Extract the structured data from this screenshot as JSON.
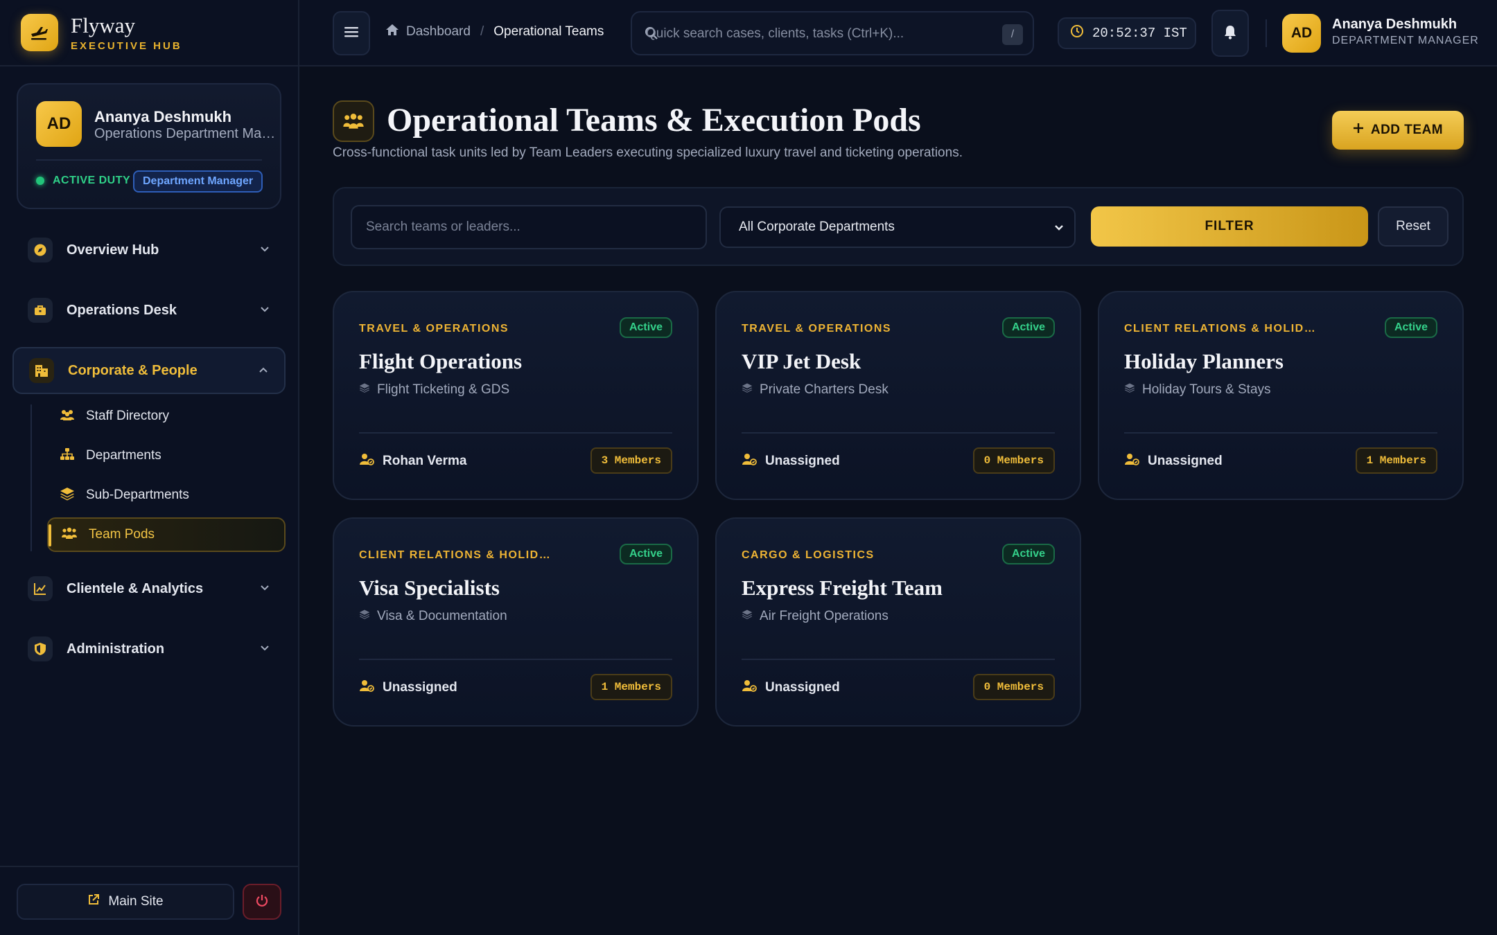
{
  "brand": {
    "name": "Flyway",
    "subtitle": "EXECUTIVE HUB"
  },
  "profile": {
    "initials": "AD",
    "name": "Ananya Deshmukh",
    "role": "Operations Department Manager",
    "duty_status": "ACTIVE DUTY",
    "badge": "Department Manager"
  },
  "sidebar": {
    "items": [
      {
        "label": "Overview Hub",
        "icon": "compass-icon"
      },
      {
        "label": "Operations Desk",
        "icon": "briefcase-icon"
      },
      {
        "label": "Corporate & People",
        "icon": "building-icon",
        "expanded": true
      },
      {
        "label": "Clientele & Analytics",
        "icon": "chart-line-icon"
      },
      {
        "label": "Administration",
        "icon": "shield-icon"
      }
    ],
    "sub_items": [
      {
        "label": "Staff Directory",
        "icon": "users-icon"
      },
      {
        "label": "Departments",
        "icon": "sitemap-icon"
      },
      {
        "label": "Sub-Departments",
        "icon": "layers-icon"
      },
      {
        "label": "Team Pods",
        "icon": "people-group-icon",
        "active": true
      }
    ],
    "footer": {
      "main_site": "Main Site"
    }
  },
  "topbar": {
    "breadcrumb": {
      "home": "Dashboard",
      "current": "Operational Teams"
    },
    "search_placeholder": "Quick search cases, clients, tasks (Ctrl+K)...",
    "search_shortcut": "/",
    "clock": "20:52:37 IST",
    "user": {
      "initials": "AD",
      "name": "Ananya Deshmukh",
      "role": "DEPARTMENT MANAGER"
    }
  },
  "page": {
    "title": "Operational Teams & Execution Pods",
    "subtitle": "Cross-functional task units led by Team Leaders executing specialized luxury travel and ticketing operations.",
    "add_button": "ADD TEAM"
  },
  "filters": {
    "search_placeholder": "Search teams or leaders...",
    "department_selected": "All Corporate Departments",
    "filter_button": "FILTER",
    "reset_button": "Reset"
  },
  "teams": [
    {
      "department": "TRAVEL & OPERATIONS",
      "status": "Active",
      "name": "Flight Operations",
      "sub_department": "Flight Ticketing & GDS",
      "leader": "Rohan Verma",
      "members": "3 Members"
    },
    {
      "department": "TRAVEL & OPERATIONS",
      "status": "Active",
      "name": "VIP Jet Desk",
      "sub_department": "Private Charters Desk",
      "leader": "Unassigned",
      "members": "0 Members"
    },
    {
      "department": "CLIENT RELATIONS & HOLIDA...",
      "status": "Active",
      "name": "Holiday Planners",
      "sub_department": "Holiday Tours & Stays",
      "leader": "Unassigned",
      "members": "1 Members"
    },
    {
      "department": "CLIENT RELATIONS & HOLIDA...",
      "status": "Active",
      "name": "Visa Specialists",
      "sub_department": "Visa & Documentation",
      "leader": "Unassigned",
      "members": "1 Members"
    },
    {
      "department": "CARGO & LOGISTICS",
      "status": "Active",
      "name": "Express Freight Team",
      "sub_department": "Air Freight Operations",
      "leader": "Unassigned",
      "members": "0 Members"
    }
  ],
  "colors": {
    "accent": "#f0bd3a",
    "background": "#0a0f1c",
    "success": "#34d08a",
    "info": "#6ea6ff"
  }
}
